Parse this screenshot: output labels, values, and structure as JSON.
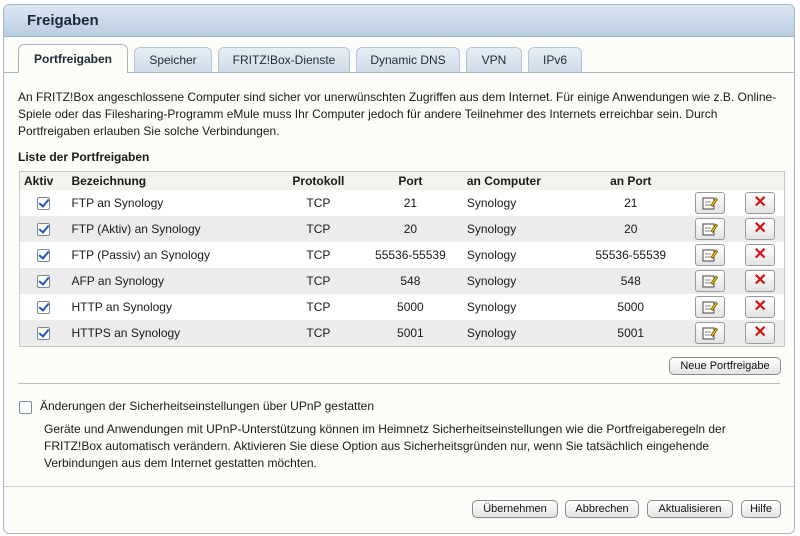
{
  "title": "Freigaben",
  "tabs": [
    "Portfreigaben",
    "Speicher",
    "FRITZ!Box-Dienste",
    "Dynamic DNS",
    "VPN",
    "IPv6"
  ],
  "intro": "An FRITZ!Box angeschlossene Computer sind sicher vor unerwünschten Zugriffen aus dem Internet. Für einige Anwendungen wie z.B. Online-Spiele oder das Filesharing-Programm eMule muss Ihr Computer jedoch für andere Teilnehmer des Internets erreichbar sein. Durch Portfreigaben erlauben Sie solche Verbindungen.",
  "list_title": "Liste der Portfreigaben",
  "columns": {
    "aktiv": "Aktiv",
    "bezeichnung": "Bezeichnung",
    "protokoll": "Protokoll",
    "port": "Port",
    "computer": "an Computer",
    "an_port": "an Port"
  },
  "rows": [
    {
      "active": true,
      "name": "FTP an Synology",
      "proto": "TCP",
      "port": "21",
      "computer": "Synology",
      "to_port": "21"
    },
    {
      "active": true,
      "name": "FTP (Aktiv) an Synology",
      "proto": "TCP",
      "port": "20",
      "computer": "Synology",
      "to_port": "20"
    },
    {
      "active": true,
      "name": "FTP (Passiv) an Synology",
      "proto": "TCP",
      "port": "55536-55539",
      "computer": "Synology",
      "to_port": "55536-55539"
    },
    {
      "active": true,
      "name": "AFP an Synology",
      "proto": "TCP",
      "port": "548",
      "computer": "Synology",
      "to_port": "548"
    },
    {
      "active": true,
      "name": "HTTP an Synology",
      "proto": "TCP",
      "port": "5000",
      "computer": "Synology",
      "to_port": "5000"
    },
    {
      "active": true,
      "name": "HTTPS an Synology",
      "proto": "TCP",
      "port": "5001",
      "computer": "Synology",
      "to_port": "5001"
    }
  ],
  "new_button": "Neue Portfreigabe",
  "upnp": {
    "checked": false,
    "label": "Änderungen der Sicherheitseinstellungen über UPnP gestatten",
    "description": "Geräte und Anwendungen mit UPnP-Unterstützung können im Heimnetz Sicherheitseinstellungen wie die Portfreigaberegeln der FRITZ!Box automatisch verändern. Aktivieren Sie diese Option aus Sicherheitsgründen nur, wenn Sie tatsächlich eingehende Verbindungen aus dem Internet gestatten möchten."
  },
  "footer": {
    "apply": "Übernehmen",
    "cancel": "Abbrechen",
    "refresh": "Aktualisieren",
    "help": "Hilfe"
  },
  "icons": {
    "edit": "edit-icon",
    "delete": "delete-icon"
  },
  "colors": {
    "title_bar": "#c8d9ea",
    "delete": "#d01414",
    "check": "#1f57b5"
  }
}
